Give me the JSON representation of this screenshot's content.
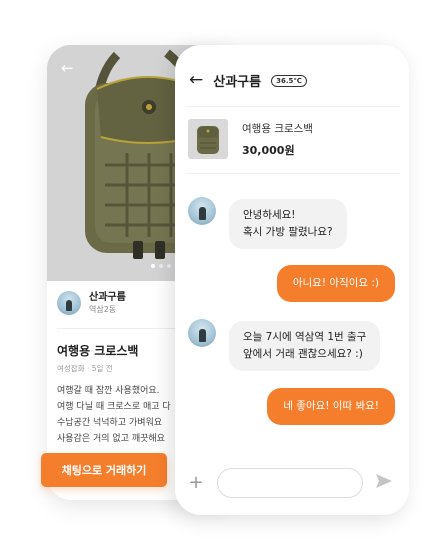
{
  "product_detail": {
    "seller": {
      "name": "산과구름",
      "location": "역삼2동"
    },
    "title": "여행용 크로스백",
    "meta": "여성잡화 · 5일 전",
    "description": [
      "여행갈 때 잠깐 사용했어요.",
      "여행 다닐 때 크로스로 매고 다",
      "수납공간 넉넉하고 가벼워요",
      "사용감은 거의 없고 깨끗해요"
    ],
    "chat_trade_button": "채팅으로 거래하기"
  },
  "chat": {
    "title": "산과구름",
    "temperature": "36.5℃",
    "product": {
      "title": "여행용 크로스백",
      "price": "30,000원"
    },
    "messages": [
      {
        "from": "other",
        "lines": [
          "안녕하세요!",
          "혹시 가방 팔렸나요?"
        ]
      },
      {
        "from": "me",
        "lines": [
          "아니요! 아직이요 :)"
        ]
      },
      {
        "from": "other",
        "lines": [
          "오늘 7시에 역삼역 1번 출구",
          "앞에서 거래 괜찮으세요? :)"
        ]
      },
      {
        "from": "me",
        "lines": [
          "네 좋아요! 이따 봐요!"
        ]
      }
    ]
  },
  "colors": {
    "accent": "#f57e2d",
    "bag_primary": "#6b6a47",
    "bag_trim": "#b8a23a"
  },
  "icons": [
    "back-arrow-icon",
    "plus-icon",
    "send-icon"
  ]
}
